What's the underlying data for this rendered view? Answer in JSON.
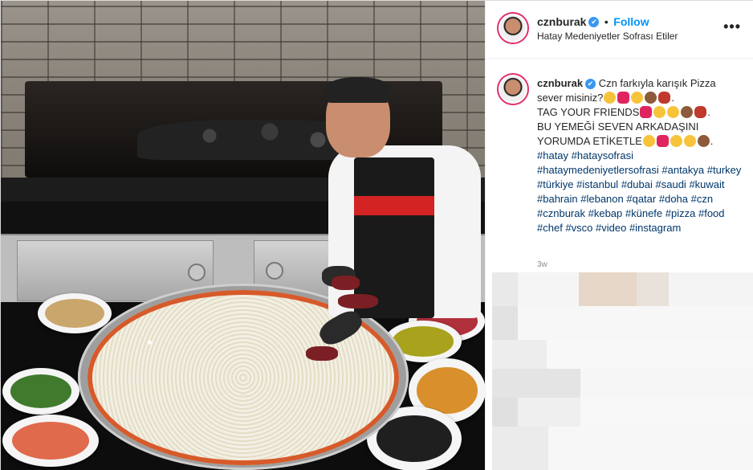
{
  "post": {
    "username": "cznburak",
    "verified_mark": "✔",
    "separator": "•",
    "follow_label": "Follow",
    "location": "Hatay Medeniyetler Sofrası Etiler",
    "more_icon": "•••"
  },
  "caption": {
    "username": "cznburak",
    "line1_text": "Czn farkıyla karışık Pizza sever misiniz?",
    "line2_text": "TAG YOUR FRIENDS",
    "line3_text": "BU YEMEĞİ SEVEN ARKADAŞINI YORUMDA ETİKETLE",
    "hashtags": [
      "#hatay",
      "#hataysofrasi",
      "#hataymedeniyetlersofrasi",
      "#antakya",
      "#turkey",
      "#türkiye",
      "#istanbul",
      "#dubai",
      "#saudi",
      "#kuwait",
      "#bahrain",
      "#lebanon",
      "#qatar",
      "#doha",
      "#czn",
      "#cznburak",
      "#kebap",
      "#künefe",
      "#pizza",
      "#food",
      "#chef",
      "#vsco",
      "#video",
      "#instagram"
    ],
    "timestamp": "3w"
  },
  "emoji_colors": {
    "laugh": "#f7c33b",
    "heart": "#e0245e",
    "monkey": "#8d5a3b",
    "meat": "#c0392b"
  },
  "colors": {
    "accent": "#0095f6",
    "verified": "#3897f0",
    "hashtag": "#00376b"
  }
}
